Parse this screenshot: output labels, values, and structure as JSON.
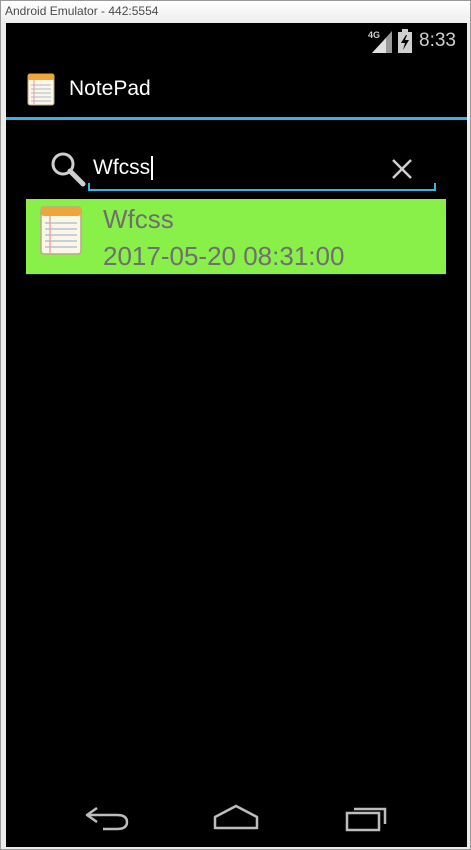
{
  "window": {
    "title": "Android Emulator - 442:5554"
  },
  "statusbar": {
    "network": "4G",
    "time": "8:33"
  },
  "actionbar": {
    "title": "NotePad",
    "icon": "notepad-icon"
  },
  "search": {
    "value": "Wfcss",
    "icon": "search-icon",
    "clear_icon": "close-icon"
  },
  "results": [
    {
      "title": "Wfcss",
      "date": "2017-05-20 08:31:00"
    }
  ],
  "navbar": {
    "back_icon": "back-icon",
    "home_icon": "home-icon",
    "recents_icon": "recents-icon"
  },
  "colors": {
    "accent": "#33b5e5",
    "result_highlight": "#88f048",
    "background": "#000000",
    "secondary_text": "#6f6f6f"
  }
}
